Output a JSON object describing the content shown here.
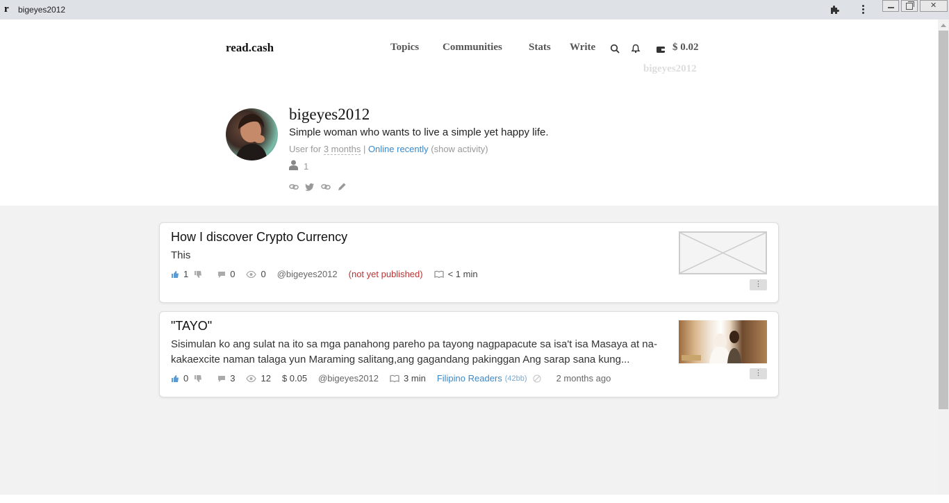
{
  "window": {
    "tab_title": "bigeyes2012",
    "favicon_letter": "r"
  },
  "nav": {
    "brand": "read.cash",
    "topics": "Topics",
    "communities": "Communities",
    "stats": "Stats",
    "write": "Write",
    "balance": "$ 0.02",
    "username": "bigeyes2012"
  },
  "profile": {
    "name": "bigeyes2012",
    "bio": "Simple woman who wants to live a simple yet happy life.",
    "user_for_prefix": "User for ",
    "user_for_value": "3 months",
    "separator": " | ",
    "online": "Online recently",
    "show_activity": " (show activity)",
    "followers": "1"
  },
  "articles": [
    {
      "title": "How I discover Crypto Currency",
      "excerpt": "This",
      "upvotes": "1",
      "comments": "0",
      "views": "0",
      "author": "@bigeyes2012",
      "status": "(not yet published)",
      "read_time": "< 1 min",
      "menu": "⋮"
    },
    {
      "title": "\"TAYO\"",
      "excerpt": "Sisimulan ko ang sulat na ito sa mga panahong pareho pa tayong nagpapacute sa isa't isa Masaya at na-kakaexcite naman talaga yun Maraming salitang,ang gagandang pakinggan Ang sarap sana kung...",
      "upvotes": "0",
      "comments": "3",
      "views": "12",
      "earnings": "$ 0.05",
      "author": "@bigeyes2012",
      "read_time": "3 min",
      "community": "Filipino Readers",
      "community_hash": "(42bb)",
      "date": "2 months ago",
      "menu": "⋮"
    }
  ],
  "colors": {
    "link": "#3b89c9",
    "unpublished": "#b33333",
    "upvote": "#5b9bd5"
  }
}
